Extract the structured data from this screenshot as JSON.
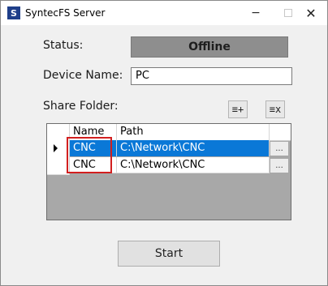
{
  "window": {
    "title": "SyntecFS Server",
    "icon_letter": "S",
    "minimize_glyph": "−",
    "close_glyph": "✕"
  },
  "status": {
    "label": "Status:",
    "value": "Offline"
  },
  "device": {
    "label": "Device Name:",
    "value": "PC"
  },
  "share": {
    "label": "Share Folder:",
    "add_button_glyph": "≡+",
    "remove_button_glyph": "≡x"
  },
  "grid": {
    "columns": [
      "Name",
      "Path"
    ],
    "rows": [
      {
        "name": "CNC",
        "path": "C:\\Network\\CNC",
        "browse": "..."
      },
      {
        "name": "CNC",
        "path": "C:\\Network\\CNC",
        "browse": "..."
      }
    ]
  },
  "actions": {
    "start_label": "Start"
  },
  "colors": {
    "selection": "#0a78d7",
    "status_bg": "#8e8e8e",
    "highlight": "#d21f1f"
  }
}
